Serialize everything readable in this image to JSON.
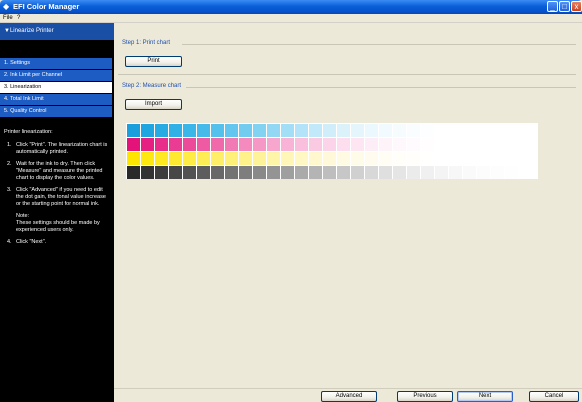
{
  "window": {
    "title": "EFI Color Manager",
    "buttons": [
      "_",
      "□",
      "x"
    ]
  },
  "menu": [
    "File",
    "?"
  ],
  "sidebar": {
    "header": "Linearize Printer",
    "items": [
      {
        "label": "1. Settings"
      },
      {
        "label": "2. Ink Limit per Channel"
      },
      {
        "label": "3. Linearization"
      },
      {
        "label": "4. Total Ink Limit"
      },
      {
        "label": "5. Quality Control"
      }
    ],
    "help_title": "Printer linearization:",
    "steps": [
      {
        "num": "1.",
        "text": "Click \"Print\". The linearization chart is automatically printed."
      },
      {
        "num": "2.",
        "text": "Wait for the ink to dry. Then click \"Measure\" and measure the printed chart to display the color values."
      },
      {
        "num": "3.",
        "text": "Click \"Advanced\" if you need to edit the dot gain, the tonal value increase or the starting point for normal ink."
      },
      {
        "num": "4.",
        "text": "Click \"Next\"."
      }
    ],
    "note_label": "Note:",
    "note_text": "These settings should be made by experienced users only."
  },
  "main": {
    "step1_label": "Step 1: Print chart",
    "print_button": "Print",
    "step2_label": "Step 2: Measure chart",
    "import_button": "Import"
  },
  "chart_colors": {
    "cyan": [
      "#1a9fdc",
      "#1fa6e0",
      "#27abe2",
      "#2fb1e5",
      "#3ab6e8",
      "#46bbea",
      "#54c1ec",
      "#62c6ee",
      "#72ccf0",
      "#82d2f2",
      "#92d8f4",
      "#a2def6",
      "#b2e3f8",
      "#c1e9f9",
      "#cfeefa",
      "#dbf2fb",
      "#e4f5fc",
      "#ebf8fd",
      "#f1fafe",
      "#f6fcfe",
      "#fafdff",
      "#fdfeff",
      "#ffffff",
      "#ffffff",
      "#ffffff",
      "#ffffff",
      "#ffffff",
      "#ffffff",
      "#ffffff"
    ],
    "magenta": [
      "#e4137a",
      "#e61f82",
      "#e82d8a",
      "#ea3c92",
      "#ec4b9a",
      "#ee5ba3",
      "#f06aab",
      "#f27ab4",
      "#f48abd",
      "#f598c6",
      "#f7a6ce",
      "#f8b3d6",
      "#f9bfdd",
      "#facae3",
      "#fbd4e9",
      "#fcdeee",
      "#fde6f2",
      "#fdedf6",
      "#fef3f9",
      "#fef7fb",
      "#fffafd",
      "#fffdfe",
      "#ffffff",
      "#ffffff",
      "#ffffff",
      "#ffffff",
      "#ffffff",
      "#ffffff",
      "#ffffff"
    ],
    "yellow": [
      "#ffe600",
      "#ffe710",
      "#ffe920",
      "#ffea32",
      "#ffec44",
      "#ffed56",
      "#ffef68",
      "#fff079",
      "#fff28a",
      "#fff39a",
      "#fff5a9",
      "#fff6b7",
      "#fff7c4",
      "#fff8cf",
      "#fff9d9",
      "#fffae2",
      "#fffbe9",
      "#fffcef",
      "#fffdf4",
      "#fffef8",
      "#fffefb",
      "#fffffd",
      "#ffffff",
      "#ffffff",
      "#ffffff",
      "#ffffff",
      "#ffffff",
      "#ffffff",
      "#ffffff"
    ],
    "black": [
      "#2a2a2a",
      "#333333",
      "#3d3d3d",
      "#474747",
      "#525252",
      "#5d5d5d",
      "#686868",
      "#737373",
      "#7e7e7e",
      "#898989",
      "#949494",
      "#9f9f9f",
      "#aaaaaa",
      "#b4b4b4",
      "#bebebe",
      "#c7c7c7",
      "#d0d0d0",
      "#d8d8d8",
      "#dfdfdf",
      "#e5e5e5",
      "#ebebeb",
      "#f0f0f0",
      "#f4f4f4",
      "#f7f7f7",
      "#fafafa",
      "#fcfcfc",
      "#fdfdfd",
      "#fefefe",
      "#ffffff"
    ]
  },
  "footer": {
    "advanced": "Advanced",
    "previous": "Previous",
    "next": "Next",
    "cancel": "Cancel"
  }
}
